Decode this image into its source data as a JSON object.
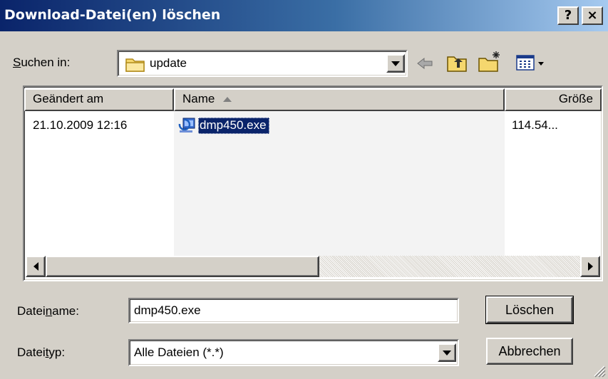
{
  "window": {
    "title": "Download-Datei(en) löschen",
    "help_button": "?",
    "close_button": "×"
  },
  "lookin": {
    "label_prefix": "",
    "label_underlined": "S",
    "label_rest": "uchen in:",
    "value": "update"
  },
  "toolbar": {
    "icons": [
      "back-arrow-icon",
      "up-folder-icon",
      "new-folder-icon",
      "view-menu-icon"
    ]
  },
  "list": {
    "columns": [
      {
        "label": "Geändert am"
      },
      {
        "label": "Name",
        "sorted": "ascending"
      },
      {
        "label": "Größe"
      }
    ],
    "rows": [
      {
        "modified": "21.10.2009 12:16",
        "name": "dmp450.exe",
        "size": "114.54..."
      }
    ]
  },
  "filename": {
    "label_prefix": "Datei",
    "label_underlined": "n",
    "label_rest": "ame:",
    "value": "dmp450.exe"
  },
  "filetype": {
    "label_prefix": "Datei",
    "label_underlined": "t",
    "label_rest": "yp:",
    "value": "Alle Dateien (*.*)"
  },
  "buttons": {
    "delete": "Löschen",
    "cancel": "Abbrechen"
  },
  "colors": {
    "title_gradient_start": "#0a246a",
    "title_gradient_end": "#a6caf0",
    "face": "#d4d0c8",
    "selection": "#0a246a"
  }
}
